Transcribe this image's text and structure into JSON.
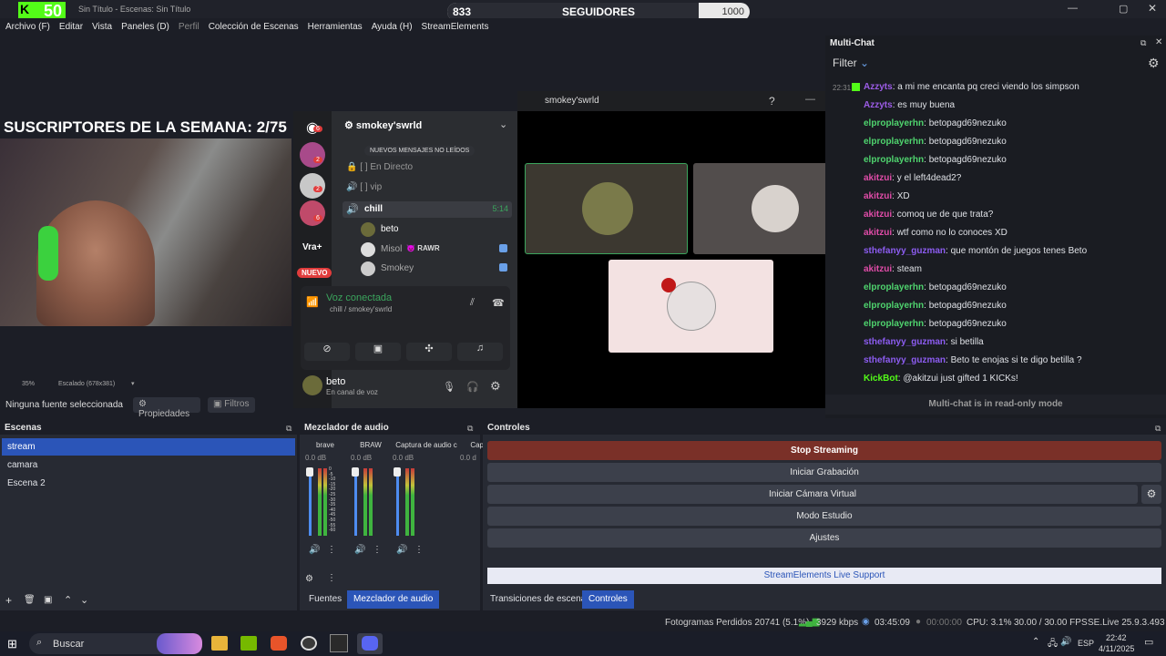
{
  "window": {
    "title": "Sin Título - Escenas: Sin Título",
    "logo_count": "50"
  },
  "followers": {
    "current": "833",
    "label": "SEGUIDORES",
    "goal": "1000",
    "progress": 0.83
  },
  "menu": [
    "Archivo (F)",
    "Editar",
    "Vista",
    "Paneles (D)",
    "Perfil",
    "Colección de Escenas",
    "Herramientas",
    "Ayuda (H)",
    "StreamElements"
  ],
  "overlay": {
    "subs": "SUSCRIPTORES DE LA SEMANA: 2/75"
  },
  "discord": {
    "window_title": "smokey'swrld",
    "server": "smokey'swrld",
    "new_msgs": "NUEVOS MENSAJES NO LEÍDOS",
    "channels": [
      "En Directo",
      "vip",
      "chill"
    ],
    "chill_time": "5:14",
    "users": [
      "beto",
      "Misol",
      "Smokey"
    ],
    "rawr": "RAWR",
    "vra": "Vra+",
    "nuevo": "NUEVO",
    "badges": [
      "6",
      "2",
      "2",
      "6"
    ],
    "voice": "Voz conectada",
    "voice_sub": "chill / smokey'swrld",
    "me": "beto",
    "me_status": "En canal de voz"
  },
  "preview_bar": {
    "zoom": "35%",
    "scale": "Escalado (678x381)"
  },
  "source_bar": {
    "none": "Ninguna fuente seleccionada",
    "props": "Propiedades",
    "filters": "Filtros"
  },
  "multichat": {
    "title": "Multi-Chat",
    "filter": "Filter",
    "footer": "Multi-chat is in read-only mode",
    "time": "22:31",
    "lines": [
      {
        "user": "Azzyts",
        "color": "#9c5ce6",
        "msg": "a mi me encanta pq creci viendo los simpson"
      },
      {
        "user": "Azzyts",
        "color": "#9c5ce6",
        "msg": "es muy buena"
      },
      {
        "user": "elproplayerhn",
        "color": "#4fd46e",
        "msg": "betopagd69nezuko"
      },
      {
        "user": "elproplayerhn",
        "color": "#4fd46e",
        "msg": "betopagd69nezuko"
      },
      {
        "user": "elproplayerhn",
        "color": "#4fd46e",
        "msg": "betopagd69nezuko"
      },
      {
        "user": "akitzui",
        "color": "#e04ca8",
        "msg": "y el left4dead2?"
      },
      {
        "user": "akitzui",
        "color": "#e04ca8",
        "msg": "XD"
      },
      {
        "user": "akitzui",
        "color": "#e04ca8",
        "msg": "comoq ue de que trata?"
      },
      {
        "user": "akitzui",
        "color": "#e04ca8",
        "msg": "wtf como no lo conoces XD"
      },
      {
        "user": "sthefanyy_guzman",
        "color": "#8c5cf0",
        "msg": "que montón de juegos tenes Beto"
      },
      {
        "user": "akitzui",
        "color": "#e04ca8",
        "msg": "steam"
      },
      {
        "user": "elproplayerhn",
        "color": "#4fd46e",
        "msg": "betopagd69nezuko"
      },
      {
        "user": "elproplayerhn",
        "color": "#4fd46e",
        "msg": "betopagd69nezuko"
      },
      {
        "user": "elproplayerhn",
        "color": "#4fd46e",
        "msg": "betopagd69nezuko"
      },
      {
        "user": "sthefanyy_guzman",
        "color": "#8c5cf0",
        "msg": "si betilla"
      },
      {
        "user": "sthefanyy_guzman",
        "color": "#8c5cf0",
        "msg": "Beto te enojas si te digo betilla ?"
      },
      {
        "user": "KickBot",
        "color": "#53fc18",
        "msg": "@akitzui just gifted 1 KICKs!"
      }
    ]
  },
  "scenes": {
    "title": "Escenas",
    "items": [
      "stream",
      "camara",
      "Escena 2"
    ]
  },
  "mixer": {
    "title": "Mezclador de audio",
    "channels": [
      {
        "name": "brave",
        "db": "0.0 dB"
      },
      {
        "name": "BRAW",
        "db": "0.0 dB"
      },
      {
        "name": "Captura de audio c",
        "db": "0.0 dB"
      },
      {
        "name": "Captu",
        "db": "0.0 d"
      }
    ],
    "scale": [
      "0",
      "-5",
      "-10",
      "-15",
      "-20",
      "-25",
      "-30",
      "-35",
      "-40",
      "-45",
      "-50",
      "-55",
      "-60"
    ]
  },
  "controls": {
    "title": "Controles",
    "stop": "Stop Streaming",
    "record": "Iniciar Grabación",
    "vcam": "Iniciar Cámara Virtual",
    "studio": "Modo Estudio",
    "settings": "Ajustes",
    "support": "StreamElements Live Support"
  },
  "tabs": {
    "fuentes": "Fuentes",
    "mezclador": "Mezclador de audio",
    "transiciones": "Transiciones de escena",
    "controles": "Controles"
  },
  "status": {
    "dropped": "Fotogramas Perdidos 20741 (5.1%)",
    "kbps": "3929 kbps",
    "live": "03:45:09",
    "rec": "00:00:00",
    "cpu": "CPU: 3.1%",
    "fps": "30.00 / 30.00 FPS",
    "version": "SE.Live 25.9.3.493"
  },
  "taskbar": {
    "search": "Buscar",
    "lang": "ESP",
    "time": "22:42",
    "date": "4/11/2025"
  }
}
